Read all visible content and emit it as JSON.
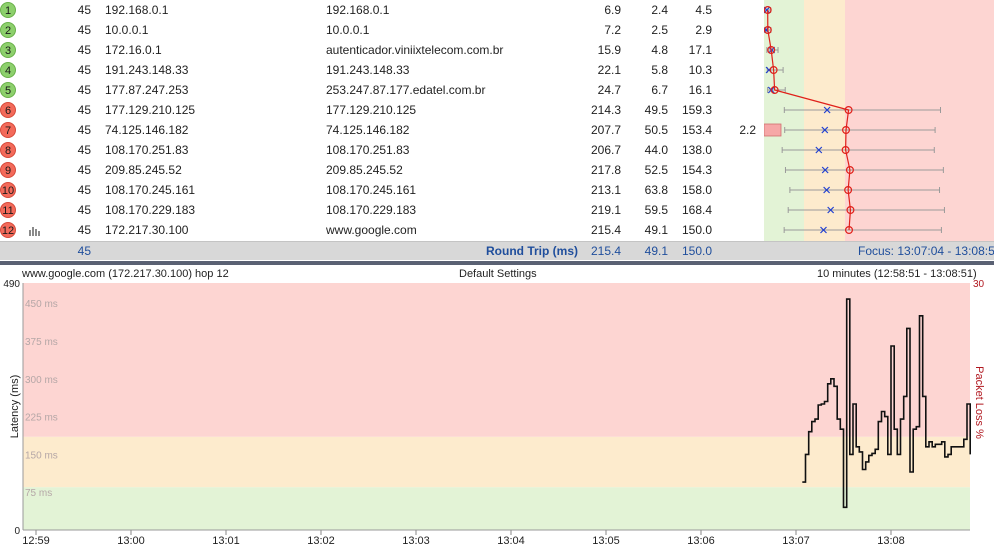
{
  "hops": [
    {
      "hop": "1",
      "status": "good",
      "count": "45",
      "ip": "192.168.0.1",
      "name": "192.168.0.1",
      "avg": "6.9",
      "min": "2.4",
      "cur": "4.5",
      "pl": ""
    },
    {
      "hop": "2",
      "status": "good",
      "count": "45",
      "ip": "10.0.0.1",
      "name": "10.0.0.1",
      "avg": "7.2",
      "min": "2.5",
      "cur": "2.9",
      "pl": ""
    },
    {
      "hop": "3",
      "status": "good",
      "count": "45",
      "ip": "172.16.0.1",
      "name": "autenticador.viniixtelecom.com.br",
      "avg": "15.9",
      "min": "4.8",
      "cur": "17.1",
      "pl": ""
    },
    {
      "hop": "4",
      "status": "good",
      "count": "45",
      "ip": "191.243.148.33",
      "name": "191.243.148.33",
      "avg": "22.1",
      "min": "5.8",
      "cur": "10.3",
      "pl": ""
    },
    {
      "hop": "5",
      "status": "good",
      "count": "45",
      "ip": "177.87.247.253",
      "name": "253.247.87.177.edatel.com.br",
      "avg": "24.7",
      "min": "6.7",
      "cur": "16.1",
      "pl": ""
    },
    {
      "hop": "6",
      "status": "bad",
      "count": "45",
      "ip": "177.129.210.125",
      "name": "177.129.210.125",
      "avg": "214.3",
      "min": "49.5",
      "cur": "159.3",
      "pl": ""
    },
    {
      "hop": "7",
      "status": "bad",
      "count": "45",
      "ip": "74.125.146.182",
      "name": "74.125.146.182",
      "avg": "207.7",
      "min": "50.5",
      "cur": "153.4",
      "pl": "2.2"
    },
    {
      "hop": "8",
      "status": "bad",
      "count": "45",
      "ip": "108.170.251.83",
      "name": "108.170.251.83",
      "avg": "206.7",
      "min": "44.0",
      "cur": "138.0",
      "pl": ""
    },
    {
      "hop": "9",
      "status": "bad",
      "count": "45",
      "ip": "209.85.245.52",
      "name": "209.85.245.52",
      "avg": "217.8",
      "min": "52.5",
      "cur": "154.3",
      "pl": ""
    },
    {
      "hop": "10",
      "status": "bad",
      "count": "45",
      "ip": "108.170.245.161",
      "name": "108.170.245.161",
      "avg": "213.1",
      "min": "63.8",
      "cur": "158.0",
      "pl": ""
    },
    {
      "hop": "11",
      "status": "bad",
      "count": "45",
      "ip": "108.170.229.183",
      "name": "108.170.229.183",
      "avg": "219.1",
      "min": "59.5",
      "cur": "168.4",
      "pl": ""
    },
    {
      "hop": "12",
      "status": "bad",
      "count": "45",
      "ip": "172.217.30.100",
      "name": "www.google.com",
      "avg": "215.4",
      "min": "49.1",
      "cur": "150.0",
      "pl": ""
    }
  ],
  "summary": {
    "count": "45",
    "label": "Round Trip (ms)",
    "avg": "215.4",
    "min": "49.1",
    "cur": "150.0",
    "focus": "Focus: 13:07:04 - 13:08:51"
  },
  "chart_header": {
    "target": "www.google.com (172.217.30.100) hop 12",
    "settings": "Default Settings",
    "range": "10 minutes (12:58:51 - 13:08:51)"
  },
  "colors": {
    "good_zone": "#e3f3d6",
    "warn_zone": "#fdebcd",
    "bad_zone": "#fdd5d2",
    "badge_good": "#8dd06c",
    "badge_bad": "#f36a5a",
    "line": "#e0201a",
    "avg_marker": "#1f3fd1"
  },
  "chart_data": {
    "type": "line",
    "ylabel": "Latency (ms)",
    "y2label": "Packet Loss %",
    "ylim": [
      0,
      490
    ],
    "y2lim": [
      0,
      30
    ],
    "y_ticks": [
      "490",
      "450 ms",
      "375 ms",
      "300 ms",
      "225 ms",
      "150 ms",
      "75 ms",
      "0"
    ],
    "y2_ticks": [
      "30"
    ],
    "x_ticks": [
      "12:59",
      "13:00",
      "13:01",
      "13:02",
      "13:03",
      "13:04",
      "13:05",
      "13:06",
      "13:07",
      "13:08"
    ],
    "zones": {
      "good_max": 85,
      "warn_max": 185
    },
    "series": [
      {
        "x": [
          "13:07:04",
          "13:07:06",
          "13:07:08",
          "13:07:10",
          "13:07:12",
          "13:07:14",
          "13:07:16",
          "13:07:18",
          "13:07:20",
          "13:07:22",
          "13:07:24",
          "13:07:26",
          "13:07:28",
          "13:07:30",
          "13:07:32",
          "13:07:34",
          "13:07:36",
          "13:07:38",
          "13:07:40",
          "13:07:42",
          "13:07:44",
          "13:07:46",
          "13:07:48",
          "13:07:50",
          "13:07:52",
          "13:07:54",
          "13:07:56",
          "13:07:58",
          "13:08:00",
          "13:08:02",
          "13:08:04",
          "13:08:06",
          "13:08:08",
          "13:08:10",
          "13:08:12",
          "13:08:14",
          "13:08:16",
          "13:08:18",
          "13:08:20",
          "13:08:22",
          "13:08:24",
          "13:08:26",
          "13:08:28",
          "13:08:30",
          "13:08:32",
          "13:08:34",
          "13:08:36",
          "13:08:38",
          "13:08:40",
          "13:08:42",
          "13:08:44",
          "13:08:46",
          "13:08:48",
          "13:08:50"
        ],
        "values": [
          95,
          150,
          195,
          215,
          220,
          248,
          250,
          255,
          290,
          300,
          285,
          220,
          200,
          45,
          458,
          150,
          250,
          165,
          155,
          120,
          135,
          148,
          152,
          160,
          215,
          235,
          225,
          150,
          365,
          200,
          150,
          220,
          265,
          400,
          115,
          200,
          205,
          425,
          265,
          165,
          175,
          165,
          170,
          170,
          175,
          145,
          150,
          165,
          165,
          165,
          165,
          180,
          250,
          150
        ]
      }
    ]
  }
}
